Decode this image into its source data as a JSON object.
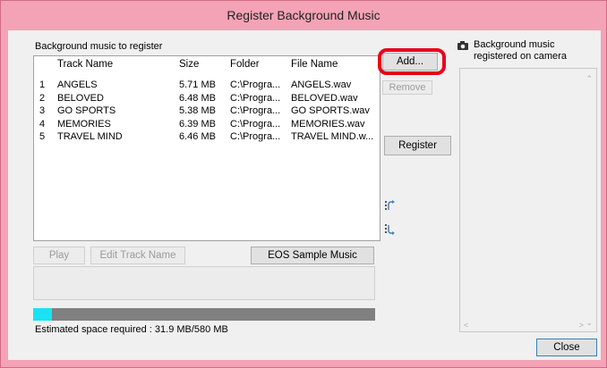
{
  "window": {
    "title": "Register Background Music"
  },
  "left_panel": {
    "section_label": "Background music to register",
    "columns": [
      "",
      "Track Name",
      "Size",
      "Folder",
      "File Name"
    ],
    "tracks": [
      {
        "num": "1",
        "name": "ANGELS",
        "size": "5.71 MB",
        "folder": "C:\\Progra...",
        "file": "ANGELS.wav"
      },
      {
        "num": "2",
        "name": "BELOVED",
        "size": "6.48 MB",
        "folder": "C:\\Progra...",
        "file": "BELOVED.wav"
      },
      {
        "num": "3",
        "name": "GO SPORTS",
        "size": "5.38 MB",
        "folder": "C:\\Progra...",
        "file": "GO SPORTS.wav"
      },
      {
        "num": "4",
        "name": "MEMORIES",
        "size": "6.39 MB",
        "folder": "C:\\Progra...",
        "file": "MEMORIES.wav"
      },
      {
        "num": "5",
        "name": "TRAVEL MIND",
        "size": "6.46 MB",
        "folder": "C:\\Progra...",
        "file": "TRAVEL MIND.w..."
      }
    ],
    "play_label": "Play",
    "edit_label": "Edit Track Name",
    "sample_label": "EOS Sample Music",
    "progress_fraction": 0.055,
    "estimate_text": "Estimated space required : 31.9 MB/580 MB"
  },
  "middle": {
    "add_label": "Add...",
    "remove_label": "Remove",
    "register_label": "Register",
    "move_up_icon": "move-up-icon",
    "move_down_icon": "move-down-icon"
  },
  "right_panel": {
    "title_line1": "Background music",
    "title_line2": "registered on camera",
    "icon": "camera-icon"
  },
  "footer": {
    "close_label": "Close"
  },
  "colors": {
    "frame": "#f4a3b6",
    "highlight": "#e8001c",
    "progress": "#19e2f2",
    "track_bg": "#808080"
  }
}
